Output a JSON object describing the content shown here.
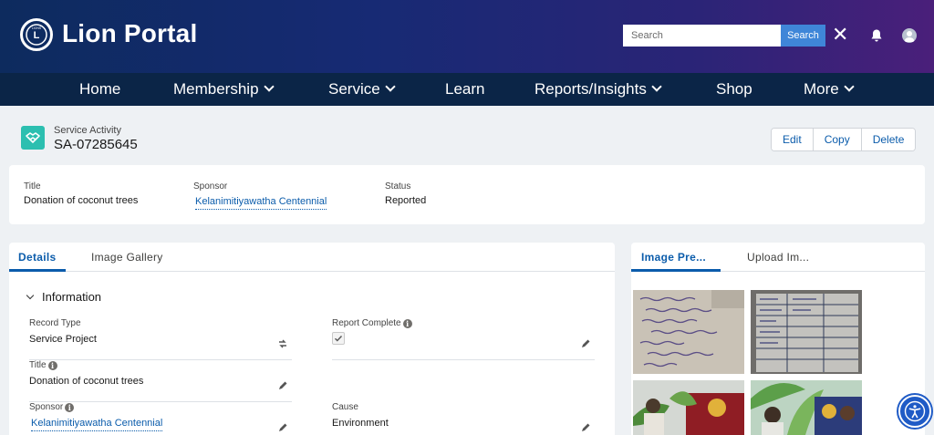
{
  "header": {
    "brand": "Lion Portal",
    "search_placeholder": "Search",
    "search_button": "Search",
    "logo_text": "LIONS"
  },
  "nav": {
    "items": [
      {
        "label": "Home"
      },
      {
        "label": "Membership"
      },
      {
        "label": "Service"
      },
      {
        "label": "Learn"
      },
      {
        "label": "Reports/Insights"
      },
      {
        "label": "Shop"
      },
      {
        "label": "More"
      }
    ]
  },
  "record": {
    "type": "Service Activity",
    "id": "SA-07285645",
    "actions": {
      "edit": "Edit",
      "copy": "Copy",
      "delete": "Delete"
    }
  },
  "highlights": {
    "title_label": "Title",
    "title_value": "Donation of coconut trees",
    "sponsor_label": "Sponsor",
    "sponsor_value": "Kelanimitiyawatha Centennial",
    "status_label": "Status",
    "status_value": "Reported"
  },
  "details": {
    "tabs": [
      "Details",
      "Image Gallery"
    ],
    "section_title": "Information",
    "fields": {
      "record_type_label": "Record Type",
      "record_type_value": "Service Project",
      "report_complete_label": "Report Complete",
      "report_complete_value": true,
      "title_label": "Title",
      "title_value": "Donation of coconut trees",
      "sponsor_label": "Sponsor",
      "sponsor_value": "Kelanimitiyawatha Centennial",
      "cause_label": "Cause",
      "cause_value": "Environment"
    }
  },
  "gallery": {
    "tabs": [
      "Image Pre...",
      "Upload Im..."
    ]
  },
  "colors": {
    "accent": "#0b5cab",
    "nav_bg": "#0b2547",
    "object_icon": "#2cbfb0"
  },
  "icons": [
    "lions-logo-icon",
    "close-icon",
    "bell-icon",
    "user-avatar-icon",
    "service-activity-icon",
    "record-type-change-icon",
    "pencil-icon",
    "info-icon",
    "checkbox-checked-icon",
    "accessibility-icon"
  ]
}
